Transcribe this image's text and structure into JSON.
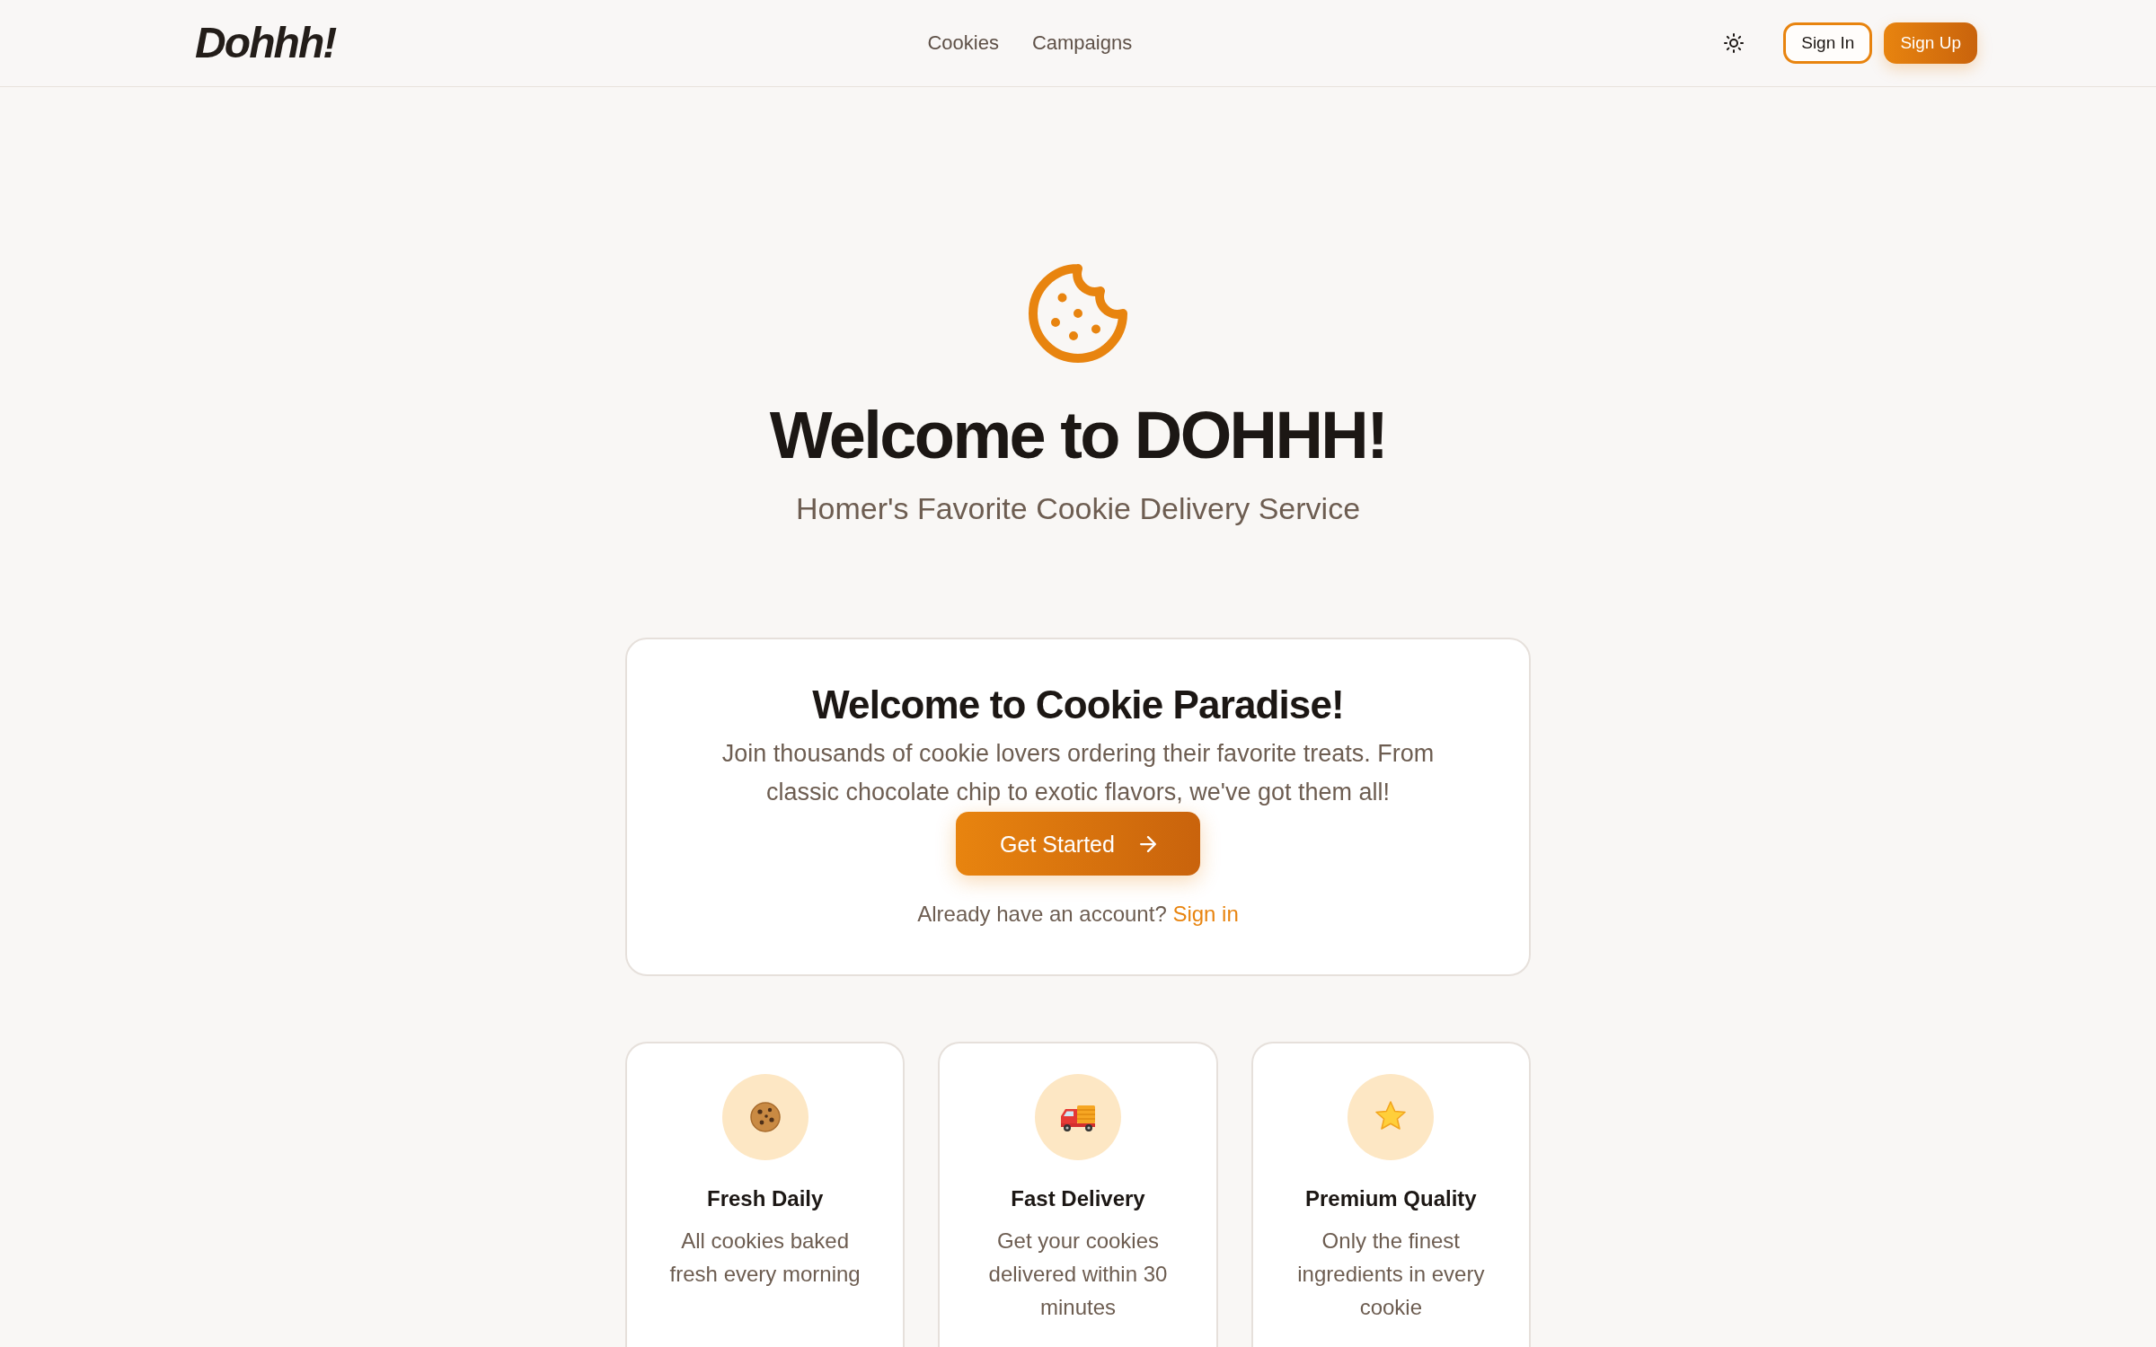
{
  "header": {
    "logo": "Dohhh!",
    "nav": [
      {
        "label": "Cookies"
      },
      {
        "label": "Campaigns"
      }
    ],
    "sign_in": "Sign In",
    "sign_up": "Sign Up"
  },
  "hero": {
    "title": "Welcome to DOHHH!",
    "subtitle": "Homer's Favorite Cookie Delivery Service"
  },
  "welcome_card": {
    "title": "Welcome to Cookie Paradise!",
    "text": "Join thousands of cookie lovers ordering their favorite treats. From classic chocolate chip to exotic flavors, we've got them all!",
    "button": "Get Started",
    "prompt": "Already have an account?",
    "link": "Sign in"
  },
  "features": [
    {
      "title": "Fresh Daily",
      "text": "All cookies baked fresh every morning"
    },
    {
      "title": "Fast Delivery",
      "text": "Get your cookies delivered within 30 minutes"
    },
    {
      "title": "Premium Quality",
      "text": "Only the finest ingredients in every cookie"
    }
  ]
}
